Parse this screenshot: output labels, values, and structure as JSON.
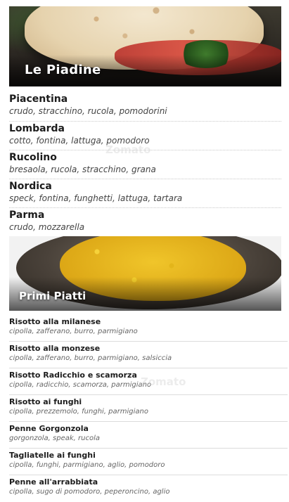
{
  "sections": {
    "piadine": {
      "title": "Le Piadine",
      "items": [
        {
          "name": "Piacentina",
          "desc": "crudo, stracchino, rucola, pomodorini"
        },
        {
          "name": "Lombarda",
          "desc": "cotto, fontina, lattuga, pomodoro"
        },
        {
          "name": "Rucolino",
          "desc": "bresaola, rucola, stracchino, grana"
        },
        {
          "name": "Nordica",
          "desc": "speck, fontina, funghetti, lattuga, tartara"
        },
        {
          "name": "Parma",
          "desc": "crudo, mozzarella"
        }
      ]
    },
    "primi": {
      "title": "Primi Piatti",
      "items": [
        {
          "name": "Risotto alla milanese",
          "desc": "cipolla, zafferano, burro, parmigiano"
        },
        {
          "name": "Risotto alla monzese",
          "desc": "cipolla, zafferano, burro, parmigiano, salsiccia"
        },
        {
          "name": "Risotto Radicchio e scamorza",
          "desc": "cipolla, radicchio, scamorza, parmigiano"
        },
        {
          "name": "Risotto ai funghi",
          "desc": "cipolla, prezzemolo, funghi, parmigiano"
        },
        {
          "name": "Penne Gorgonzola",
          "desc": "gorgonzola, speak, rucola"
        },
        {
          "name": "Tagliatelle ai funghi",
          "desc": "cipolla, funghi, parmigiano, aglio, pomodoro"
        },
        {
          "name": "Penne all'arrabbiata",
          "desc": "cipolla, sugo di pomodoro, peperoncino, aglio"
        }
      ]
    }
  },
  "watermark": "Zomato"
}
